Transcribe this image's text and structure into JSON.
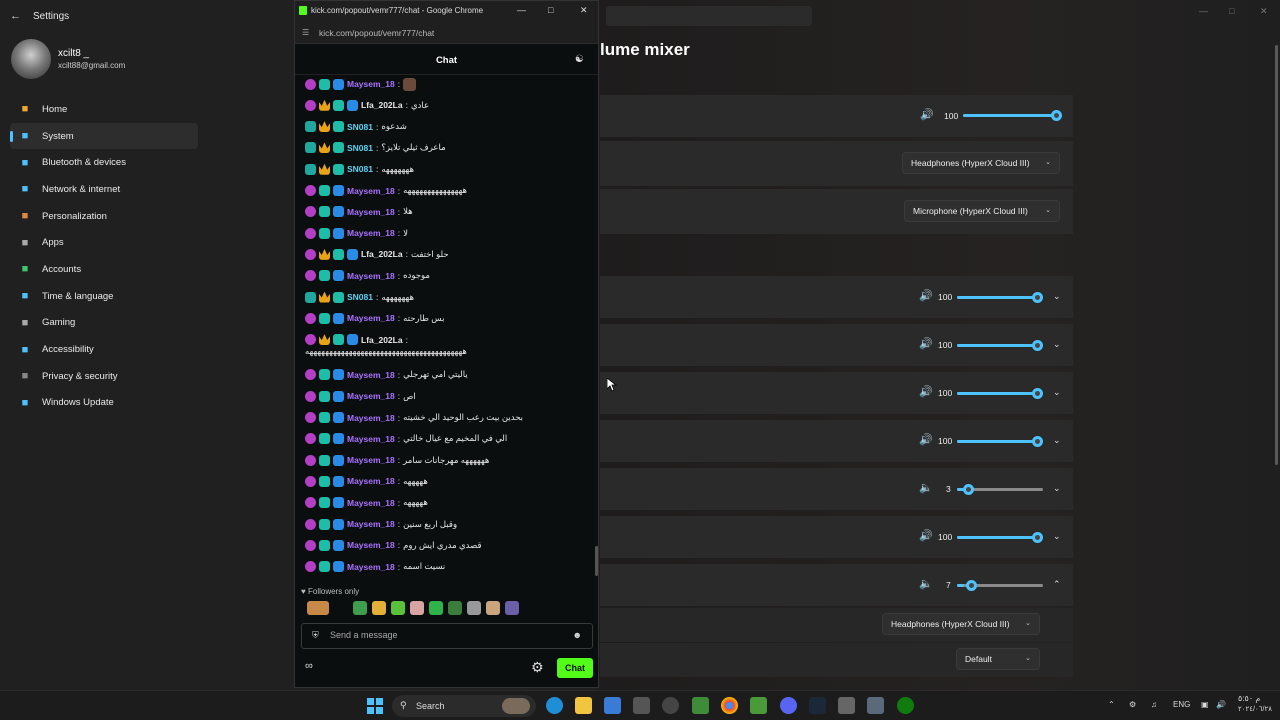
{
  "settings": {
    "title": "Settings",
    "user": {
      "name": "xcilt8 _",
      "email": "xcilt88@gmail.com"
    },
    "nav": [
      {
        "label": "Home",
        "icon": "home-icon",
        "color": "#f0a830"
      },
      {
        "label": "System",
        "icon": "system-icon",
        "color": "#4cc2ff",
        "active": true
      },
      {
        "label": "Bluetooth & devices",
        "icon": "bluetooth-icon",
        "color": "#4cc2ff"
      },
      {
        "label": "Network & internet",
        "icon": "wifi-icon",
        "color": "#4cc2ff"
      },
      {
        "label": "Personalization",
        "icon": "brush-icon",
        "color": "#e08a40"
      },
      {
        "label": "Apps",
        "icon": "apps-icon",
        "color": "#aaaaaa"
      },
      {
        "label": "Accounts",
        "icon": "account-icon",
        "color": "#3cc76a"
      },
      {
        "label": "Time & language",
        "icon": "globe-icon",
        "color": "#4cc2ff"
      },
      {
        "label": "Gaming",
        "icon": "controller-icon",
        "color": "#aaaaaa"
      },
      {
        "label": "Accessibility",
        "icon": "accessibility-icon",
        "color": "#4cc2ff"
      },
      {
        "label": "Privacy & security",
        "icon": "shield-icon",
        "color": "#888888"
      },
      {
        "label": "Windows Update",
        "icon": "update-icon",
        "color": "#4cc2ff"
      }
    ],
    "volume_mixer": {
      "title_partial": "lume mixer",
      "master_volume": "100",
      "output_device": "Headphones (HyperX Cloud III)",
      "input_device": "Microphone (HyperX Cloud III)",
      "apps": [
        {
          "value": "100",
          "level": 100
        },
        {
          "value": "100",
          "level": 100
        },
        {
          "value": "100",
          "level": 100
        },
        {
          "value": "100",
          "level": 100
        },
        {
          "value": "3",
          "level": 3
        },
        {
          "value": "100",
          "level": 100
        },
        {
          "value": "7",
          "level": 7
        }
      ],
      "app_output_device": "Headphones (HyperX Cloud III)",
      "app_input_device": "Default"
    }
  },
  "browser": {
    "window_title": "kick.com/popout/vemr777/chat - Google Chrome",
    "url": "kick.com/popout/vemr777/chat"
  },
  "chat": {
    "header": "Chat",
    "messages": [
      {
        "user": "Maysem_18",
        "sep": ":",
        "text": "",
        "badges": [
          "sub",
          "mod",
          "vip"
        ],
        "color": "maysem"
      },
      {
        "user": "Lfa_202La",
        "sep": ":",
        "text": "عادي",
        "badges": [
          "sub",
          "crown",
          "mod",
          "vip"
        ],
        "color": "lfa"
      },
      {
        "user": "SN081",
        "sep": ":",
        "text": "شدعوه",
        "badges": [
          "sub2",
          "crown",
          "mod"
        ],
        "color": "sn"
      },
      {
        "user": "SN081",
        "sep": ":",
        "text": "ماعرف ثيلي تلايز؟",
        "badges": [
          "sub2",
          "crown",
          "mod"
        ],
        "color": "sn"
      },
      {
        "user": "SN081",
        "sep": ":",
        "text": "هههههههه",
        "badges": [
          "sub2",
          "crown",
          "mod"
        ],
        "color": "sn"
      },
      {
        "user": "Maysem_18",
        "sep": ":",
        "text": "هههههههههههههههه",
        "badges": [
          "sub",
          "mod",
          "vip"
        ],
        "color": "maysem"
      },
      {
        "user": "Maysem_18",
        "sep": ":",
        "text": "هلا",
        "badges": [
          "sub",
          "mod",
          "vip"
        ],
        "color": "maysem"
      },
      {
        "user": "Maysem_18",
        "sep": ":",
        "text": "لا",
        "badges": [
          "sub",
          "mod",
          "vip"
        ],
        "color": "maysem"
      },
      {
        "user": "Lfa_202La",
        "sep": ":",
        "text": "حلو اختفت",
        "badges": [
          "sub",
          "crown",
          "mod",
          "vip"
        ],
        "color": "lfa"
      },
      {
        "user": "Maysem_18",
        "sep": ":",
        "text": "موجوده",
        "badges": [
          "sub",
          "mod",
          "vip"
        ],
        "color": "maysem"
      },
      {
        "user": "SN081",
        "sep": ":",
        "text": "هههههههه",
        "badges": [
          "sub2",
          "crown",
          "mod"
        ],
        "color": "sn"
      },
      {
        "user": "Maysem_18",
        "sep": ":",
        "text": "بس طارحته",
        "badges": [
          "sub",
          "mod",
          "vip"
        ],
        "color": "maysem"
      },
      {
        "user": "Lfa_202La",
        "sep": ":",
        "text": "",
        "badges": [
          "sub",
          "crown",
          "mod",
          "vip"
        ],
        "color": "lfa"
      },
      {
        "user": "Maysem_18",
        "sep": ":",
        "text": "ياليتي امي تهرجلي",
        "badges": [
          "sub",
          "mod",
          "vip"
        ],
        "color": "maysem"
      },
      {
        "user": "Maysem_18",
        "sep": ":",
        "text": "اص",
        "badges": [
          "sub",
          "mod",
          "vip"
        ],
        "color": "maysem"
      },
      {
        "user": "Maysem_18",
        "sep": ":",
        "text": "بحدين بيت رعب الوحيد الي خشيته",
        "badges": [
          "sub",
          "mod",
          "vip"
        ],
        "color": "maysem"
      },
      {
        "user": "Maysem_18",
        "sep": ":",
        "text": "الي في المخيم مع عيال خالتي",
        "badges": [
          "sub",
          "mod",
          "vip"
        ],
        "color": "maysem"
      },
      {
        "user": "Maysem_18",
        "sep": ":",
        "text": "ههههههه مهرجانات سامر",
        "badges": [
          "sub",
          "mod",
          "vip"
        ],
        "color": "maysem"
      },
      {
        "user": "Maysem_18",
        "sep": ":",
        "text": "هههههه",
        "badges": [
          "sub",
          "mod",
          "vip"
        ],
        "color": "maysem"
      },
      {
        "user": "Maysem_18",
        "sep": ":",
        "text": "هههههه",
        "badges": [
          "sub",
          "mod",
          "vip"
        ],
        "color": "maysem"
      },
      {
        "user": "Maysem_18",
        "sep": ":",
        "text": "وقبل اربع سنين",
        "badges": [
          "sub",
          "mod",
          "vip"
        ],
        "color": "maysem"
      },
      {
        "user": "Maysem_18",
        "sep": ":",
        "text": "قصدي مدري ايش روم",
        "badges": [
          "sub",
          "mod",
          "vip"
        ],
        "color": "maysem"
      },
      {
        "user": "Maysem_18",
        "sep": ":",
        "text": "نسيت اسمه",
        "badges": [
          "sub",
          "mod",
          "vip"
        ],
        "color": "maysem"
      }
    ],
    "wrapped_line": "ههههههههههههههههههههههههههههههههههههههههه",
    "followers_only": "Followers only",
    "input_placeholder": "Send a message",
    "send_label": "Chat"
  },
  "taskbar": {
    "search_label": "Search",
    "lang": "ENG",
    "time": "م ٥:٥٠",
    "date": "٢٠٢٤/٠٦/٢٨"
  }
}
